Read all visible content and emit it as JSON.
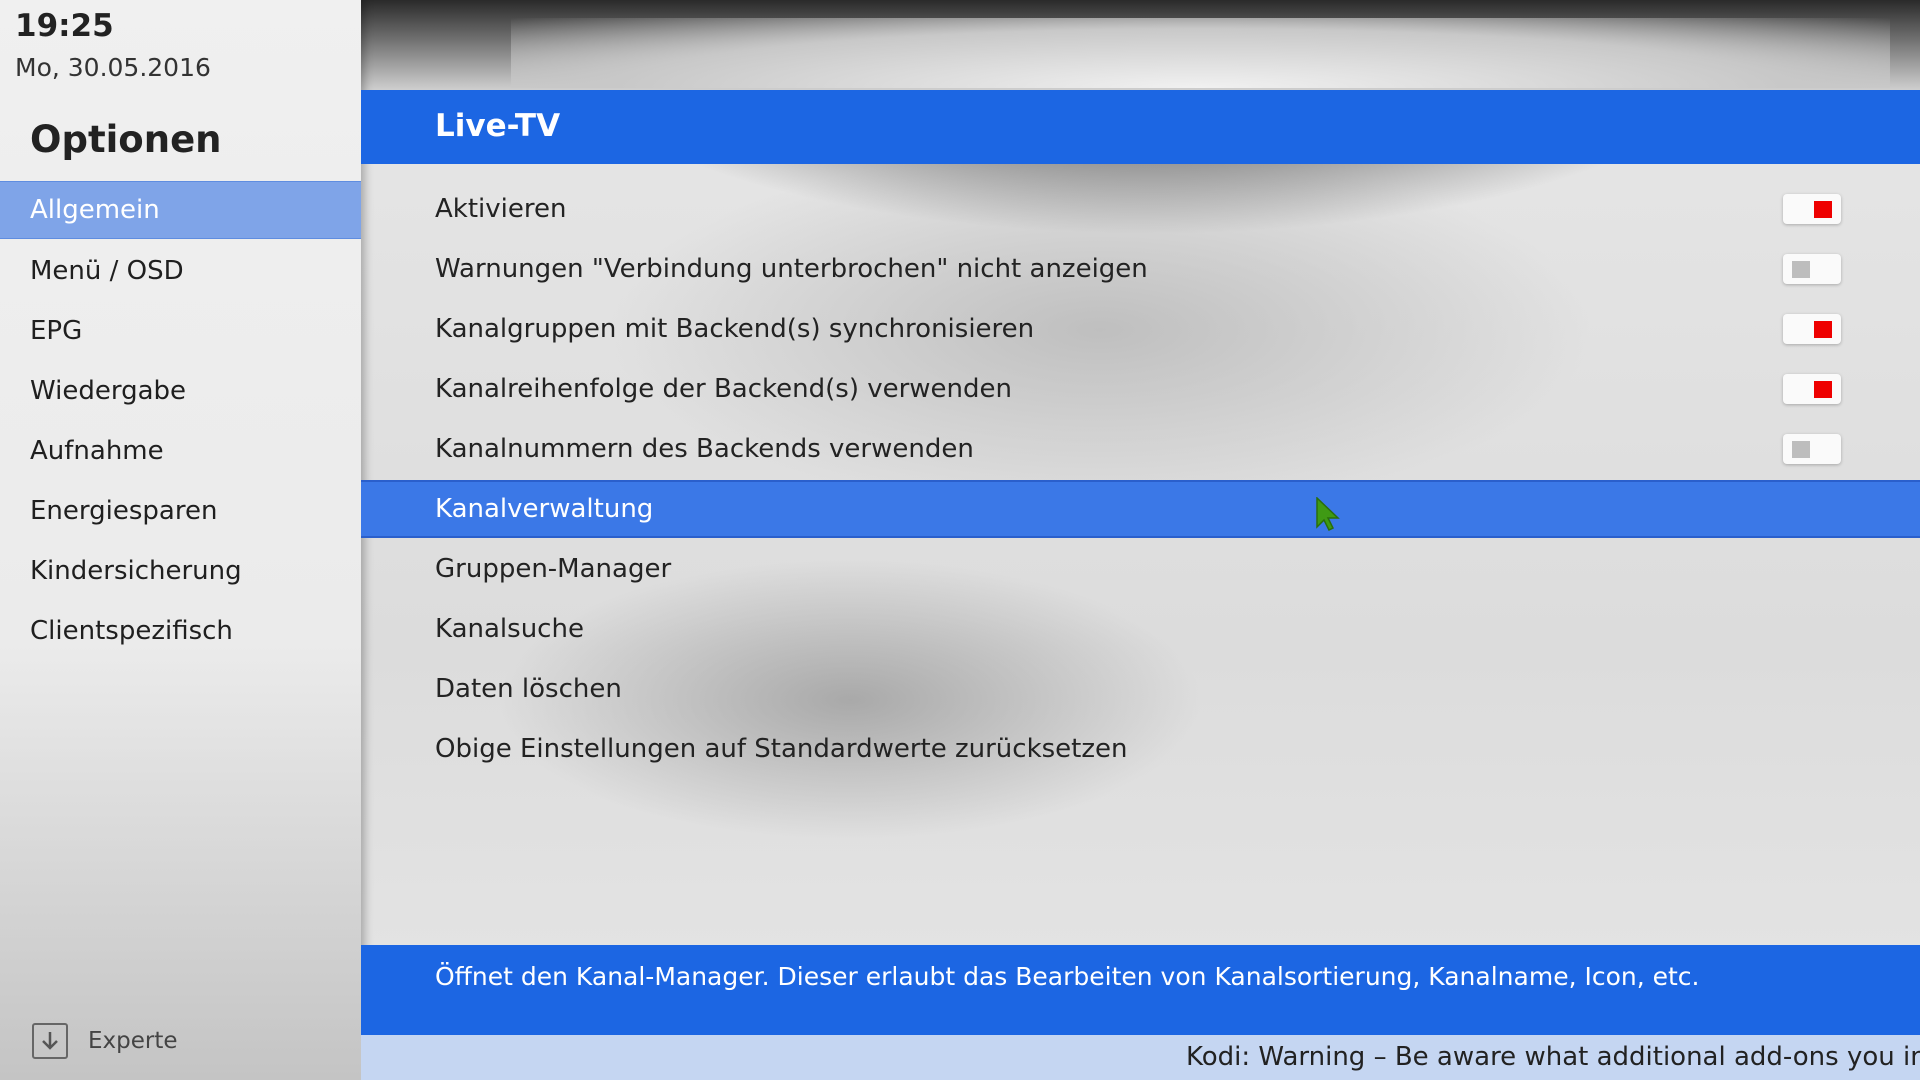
{
  "status": {
    "time": "19:25",
    "date": "Mo, 30.05.2016"
  },
  "sidebar": {
    "title": "Optionen",
    "items": [
      {
        "label": "Allgemein",
        "active": true
      },
      {
        "label": "Menü / OSD"
      },
      {
        "label": "EPG"
      },
      {
        "label": "Wiedergabe"
      },
      {
        "label": "Aufnahme"
      },
      {
        "label": "Energiesparen"
      },
      {
        "label": "Kindersicherung"
      },
      {
        "label": "Clientspezifisch"
      }
    ],
    "level_label": "Experte",
    "level_icon": "arrow-down-icon"
  },
  "header": {
    "title": "Live-TV"
  },
  "settings": [
    {
      "label": "Aktivieren",
      "toggle": true,
      "value": "on"
    },
    {
      "label": "Warnungen \"Verbindung unterbrochen\" nicht anzeigen",
      "toggle": true,
      "value": "off"
    },
    {
      "label": "Kanalgruppen mit Backend(s) synchronisieren",
      "toggle": true,
      "value": "on"
    },
    {
      "label": "Kanalreihenfolge der Backend(s) verwenden",
      "toggle": true,
      "value": "on"
    },
    {
      "label": "Kanalnummern des Backends verwenden",
      "toggle": true,
      "value": "off"
    },
    {
      "label": "Kanalverwaltung",
      "focused": true
    },
    {
      "label": "Gruppen-Manager"
    },
    {
      "label": "Kanalsuche"
    },
    {
      "label": "Daten löschen"
    },
    {
      "label": "Obige Einstellungen auf Standardwerte zurücksetzen"
    }
  ],
  "info": {
    "description": "Öffnet den Kanal-Manager. Dieser erlaubt das Bearbeiten von Kanalsortierung, Kanalname, Icon, etc."
  },
  "ticker": {
    "text": "Kodi: Warning – Be aware what additional add-ons you insta"
  },
  "colors": {
    "accent": "#1c66e3",
    "focus": "#3b78e7",
    "toggle_on": "#ee0000",
    "toggle_off": "#bdbdbd",
    "sidebar_active": "#7fa4e8"
  }
}
